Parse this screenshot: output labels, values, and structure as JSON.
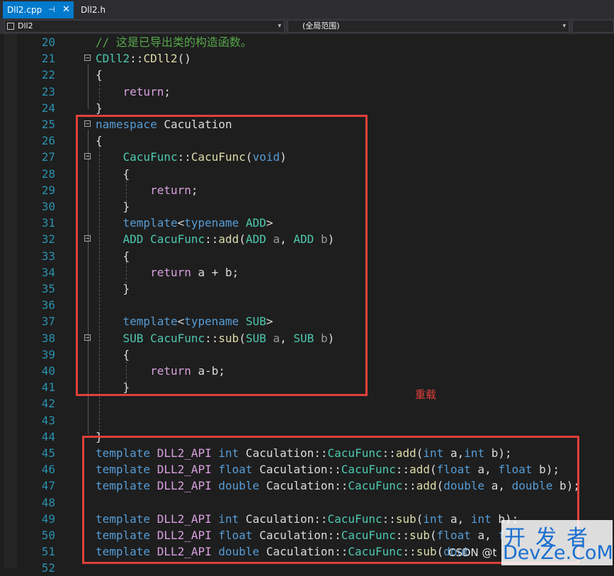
{
  "tabs": [
    {
      "label": "Dll2.cpp",
      "pin_glyph": "⊣",
      "close_glyph": "✕"
    },
    {
      "label": "Dll2.h"
    }
  ],
  "nav": {
    "project": "Dll2",
    "scope": "(全局范围)"
  },
  "colors": {
    "keyword": "#569cd6",
    "type": "#4ec9b0",
    "function": "#dcdcaa",
    "comment": "#57a64a",
    "control": "#d8a0df",
    "text": "#dcdcdc",
    "param": "#9a9a9a",
    "line_number": "#2b91af",
    "annotation_red": "#e0403a"
  },
  "lines": [
    {
      "n": "20",
      "tokens": [
        {
          "t": "// 这是已导出类的构造函数。",
          "c": "comment"
        }
      ]
    },
    {
      "n": "21",
      "tokens": [
        {
          "t": "CDll2",
          "c": "type"
        },
        {
          "t": "::",
          "c": "text"
        },
        {
          "t": "CDll2",
          "c": "function"
        },
        {
          "t": "()",
          "c": "text"
        }
      ]
    },
    {
      "n": "22",
      "tokens": [
        {
          "t": "{",
          "c": "text"
        }
      ]
    },
    {
      "n": "23",
      "tokens": [
        {
          "t": "    ",
          "c": "text"
        },
        {
          "t": "return",
          "c": "control"
        },
        {
          "t": ";",
          "c": "text"
        }
      ]
    },
    {
      "n": "24",
      "tokens": [
        {
          "t": "}",
          "c": "text"
        }
      ]
    },
    {
      "n": "25",
      "tokens": [
        {
          "t": "namespace",
          "c": "keyword"
        },
        {
          "t": " Caculation",
          "c": "text"
        }
      ]
    },
    {
      "n": "26",
      "tokens": [
        {
          "t": "{",
          "c": "text"
        }
      ]
    },
    {
      "n": "27",
      "tokens": [
        {
          "t": "    ",
          "c": "text"
        },
        {
          "t": "CacuFunc",
          "c": "type"
        },
        {
          "t": "::",
          "c": "text"
        },
        {
          "t": "CacuFunc",
          "c": "function"
        },
        {
          "t": "(",
          "c": "text"
        },
        {
          "t": "void",
          "c": "keyword"
        },
        {
          "t": ")",
          "c": "text"
        }
      ]
    },
    {
      "n": "28",
      "tokens": [
        {
          "t": "    {",
          "c": "text"
        }
      ]
    },
    {
      "n": "29",
      "tokens": [
        {
          "t": "        ",
          "c": "text"
        },
        {
          "t": "return",
          "c": "control"
        },
        {
          "t": ";",
          "c": "text"
        }
      ]
    },
    {
      "n": "30",
      "tokens": [
        {
          "t": "    }",
          "c": "text"
        }
      ]
    },
    {
      "n": "31",
      "tokens": [
        {
          "t": "    ",
          "c": "text"
        },
        {
          "t": "template",
          "c": "keyword"
        },
        {
          "t": "<",
          "c": "text"
        },
        {
          "t": "typename",
          "c": "keyword"
        },
        {
          "t": " ",
          "c": "text"
        },
        {
          "t": "ADD",
          "c": "type"
        },
        {
          "t": ">",
          "c": "text"
        }
      ]
    },
    {
      "n": "32",
      "tokens": [
        {
          "t": "    ",
          "c": "text"
        },
        {
          "t": "ADD",
          "c": "type"
        },
        {
          "t": " ",
          "c": "text"
        },
        {
          "t": "CacuFunc",
          "c": "type"
        },
        {
          "t": "::",
          "c": "text"
        },
        {
          "t": "add",
          "c": "function"
        },
        {
          "t": "(",
          "c": "text"
        },
        {
          "t": "ADD",
          "c": "type"
        },
        {
          "t": " ",
          "c": "text"
        },
        {
          "t": "a",
          "c": "param"
        },
        {
          "t": ", ",
          "c": "text"
        },
        {
          "t": "ADD",
          "c": "type"
        },
        {
          "t": " ",
          "c": "text"
        },
        {
          "t": "b",
          "c": "param"
        },
        {
          "t": ")",
          "c": "text"
        }
      ]
    },
    {
      "n": "33",
      "tokens": [
        {
          "t": "    {",
          "c": "text"
        }
      ]
    },
    {
      "n": "34",
      "tokens": [
        {
          "t": "        ",
          "c": "text"
        },
        {
          "t": "return",
          "c": "control"
        },
        {
          "t": " a + b;",
          "c": "text"
        }
      ]
    },
    {
      "n": "35",
      "tokens": [
        {
          "t": "    }",
          "c": "text"
        }
      ]
    },
    {
      "n": "36",
      "tokens": []
    },
    {
      "n": "37",
      "tokens": [
        {
          "t": "    ",
          "c": "text"
        },
        {
          "t": "template",
          "c": "keyword"
        },
        {
          "t": "<",
          "c": "text"
        },
        {
          "t": "typename",
          "c": "keyword"
        },
        {
          "t": " ",
          "c": "text"
        },
        {
          "t": "SUB",
          "c": "type"
        },
        {
          "t": ">",
          "c": "text"
        }
      ]
    },
    {
      "n": "38",
      "tokens": [
        {
          "t": "    ",
          "c": "text"
        },
        {
          "t": "SUB",
          "c": "type"
        },
        {
          "t": " ",
          "c": "text"
        },
        {
          "t": "CacuFunc",
          "c": "type"
        },
        {
          "t": "::",
          "c": "text"
        },
        {
          "t": "sub",
          "c": "function"
        },
        {
          "t": "(",
          "c": "text"
        },
        {
          "t": "SUB",
          "c": "type"
        },
        {
          "t": " ",
          "c": "text"
        },
        {
          "t": "a",
          "c": "param"
        },
        {
          "t": ", ",
          "c": "text"
        },
        {
          "t": "SUB",
          "c": "type"
        },
        {
          "t": " ",
          "c": "text"
        },
        {
          "t": "b",
          "c": "param"
        },
        {
          "t": ")",
          "c": "text"
        }
      ]
    },
    {
      "n": "39",
      "tokens": [
        {
          "t": "    {",
          "c": "text"
        }
      ]
    },
    {
      "n": "40",
      "tokens": [
        {
          "t": "        ",
          "c": "text"
        },
        {
          "t": "return",
          "c": "control"
        },
        {
          "t": " a-b;",
          "c": "text"
        }
      ]
    },
    {
      "n": "41",
      "tokens": [
        {
          "t": "    }",
          "c": "text"
        }
      ]
    },
    {
      "n": "42",
      "tokens": []
    },
    {
      "n": "43",
      "tokens": []
    },
    {
      "n": "44",
      "tokens": [
        {
          "t": "}",
          "c": "text"
        }
      ]
    },
    {
      "n": "45",
      "tokens": [
        {
          "t": "template",
          "c": "keyword"
        },
        {
          "t": " DLL2_API ",
          "c": "control"
        },
        {
          "t": "int",
          "c": "keyword"
        },
        {
          "t": " Caculation::",
          "c": "text"
        },
        {
          "t": "CacuFunc",
          "c": "type"
        },
        {
          "t": "::",
          "c": "text"
        },
        {
          "t": "add",
          "c": "function"
        },
        {
          "t": "(",
          "c": "text"
        },
        {
          "t": "int",
          "c": "keyword"
        },
        {
          "t": " a,",
          "c": "text"
        },
        {
          "t": "int",
          "c": "keyword"
        },
        {
          "t": " b);",
          "c": "text"
        }
      ]
    },
    {
      "n": "46",
      "tokens": [
        {
          "t": "template",
          "c": "keyword"
        },
        {
          "t": " DLL2_API ",
          "c": "control"
        },
        {
          "t": "float",
          "c": "keyword"
        },
        {
          "t": " Caculation::",
          "c": "text"
        },
        {
          "t": "CacuFunc",
          "c": "type"
        },
        {
          "t": "::",
          "c": "text"
        },
        {
          "t": "add",
          "c": "function"
        },
        {
          "t": "(",
          "c": "text"
        },
        {
          "t": "float",
          "c": "keyword"
        },
        {
          "t": " a, ",
          "c": "text"
        },
        {
          "t": "float",
          "c": "keyword"
        },
        {
          "t": " b);",
          "c": "text"
        }
      ]
    },
    {
      "n": "47",
      "tokens": [
        {
          "t": "template",
          "c": "keyword"
        },
        {
          "t": " DLL2_API ",
          "c": "control"
        },
        {
          "t": "double",
          "c": "keyword"
        },
        {
          "t": " Caculation::",
          "c": "text"
        },
        {
          "t": "CacuFunc",
          "c": "type"
        },
        {
          "t": "::",
          "c": "text"
        },
        {
          "t": "add",
          "c": "function"
        },
        {
          "t": "(",
          "c": "text"
        },
        {
          "t": "double",
          "c": "keyword"
        },
        {
          "t": " a, ",
          "c": "text"
        },
        {
          "t": "double",
          "c": "keyword"
        },
        {
          "t": " b);",
          "c": "text"
        }
      ]
    },
    {
      "n": "48",
      "tokens": []
    },
    {
      "n": "49",
      "tokens": [
        {
          "t": "template",
          "c": "keyword"
        },
        {
          "t": " DLL2_API ",
          "c": "control"
        },
        {
          "t": "int",
          "c": "keyword"
        },
        {
          "t": " Caculation::",
          "c": "text"
        },
        {
          "t": "CacuFunc",
          "c": "type"
        },
        {
          "t": "::",
          "c": "text"
        },
        {
          "t": "sub",
          "c": "function"
        },
        {
          "t": "(",
          "c": "text"
        },
        {
          "t": "int",
          "c": "keyword"
        },
        {
          "t": " a, ",
          "c": "text"
        },
        {
          "t": "int",
          "c": "keyword"
        },
        {
          "t": " b);",
          "c": "text"
        }
      ]
    },
    {
      "n": "50",
      "tokens": [
        {
          "t": "template",
          "c": "keyword"
        },
        {
          "t": " DLL2_API ",
          "c": "control"
        },
        {
          "t": "float",
          "c": "keyword"
        },
        {
          "t": " Caculation::",
          "c": "text"
        },
        {
          "t": "CacuFunc",
          "c": "type"
        },
        {
          "t": "::",
          "c": "text"
        },
        {
          "t": "sub",
          "c": "function"
        },
        {
          "t": "(",
          "c": "text"
        },
        {
          "t": "float",
          "c": "keyword"
        },
        {
          "t": " a, ",
          "c": "text"
        },
        {
          "t": "fl",
          "c": "keyword"
        }
      ]
    },
    {
      "n": "51",
      "tokens": [
        {
          "t": "template",
          "c": "keyword"
        },
        {
          "t": " DLL2_API ",
          "c": "control"
        },
        {
          "t": "double",
          "c": "keyword"
        },
        {
          "t": " Caculation::",
          "c": "text"
        },
        {
          "t": "CacuFunc",
          "c": "type"
        },
        {
          "t": "::",
          "c": "text"
        },
        {
          "t": "sub",
          "c": "function"
        },
        {
          "t": "(",
          "c": "text"
        },
        {
          "t": "doub",
          "c": "keyword"
        }
      ]
    },
    {
      "n": "52",
      "tokens": []
    }
  ],
  "annotation": "重载",
  "watermark": {
    "csdn": "CSDN @t",
    "cn": "开发者",
    "en": "DevZe.CoM"
  }
}
